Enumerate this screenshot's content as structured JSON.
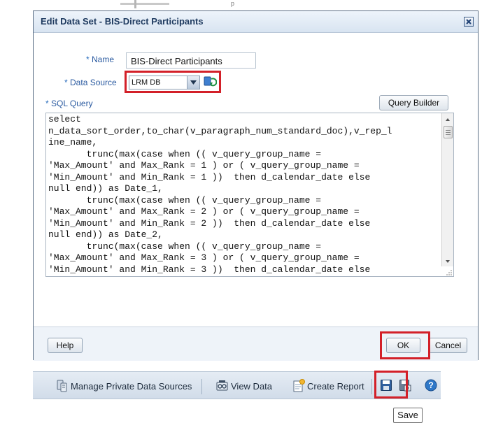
{
  "dialog": {
    "title": "Edit Data Set - BIS-Direct Participants",
    "close_icon": "close-icon",
    "name": {
      "required_mark": "*",
      "label": "Name",
      "value": "BIS-Direct Participants"
    },
    "data_source": {
      "required_mark": "*",
      "label": "Data Source",
      "value": "LRM DB",
      "refresh_icon": "refresh-datasource-icon"
    },
    "sql_query": {
      "required_mark": "*",
      "label": "SQL Query",
      "query_builder_label": "Query Builder",
      "text": "select\nn_data_sort_order,to_char(v_paragraph_num_standard_doc),v_rep_l\nine_name,\n       trunc(max(case when (( v_query_group_name =\n'Max_Amount' and Max_Rank = 1 ) or ( v_query_group_name =\n'Min_Amount' and Min_Rank = 1 ))  then d_calendar_date else\nnull end)) as Date_1,\n       trunc(max(case when (( v_query_group_name =\n'Max_Amount' and Max_Rank = 2 ) or ( v_query_group_name =\n'Min_Amount' and Min_Rank = 2 ))  then d_calendar_date else\nnull end)) as Date_2,\n       trunc(max(case when (( v_query_group_name =\n'Max_Amount' and Max_Rank = 3 ) or ( v_query_group_name =\n'Min_Amount' and Min_Rank = 3 ))  then d_calendar_date else"
    },
    "buttons": {
      "help": "Help",
      "ok": "OK",
      "cancel": "Cancel"
    }
  },
  "toolbar": {
    "items": [
      {
        "label": "Manage Private Data Sources",
        "icon": "manage-datasources-icon"
      },
      {
        "label": "View Data",
        "icon": "view-data-icon"
      },
      {
        "label": "Create Report",
        "icon": "create-report-icon"
      }
    ],
    "icon_buttons": [
      "save-icon",
      "save-as-icon",
      "help-icon"
    ]
  },
  "tooltip": {
    "text": "Save"
  },
  "colors": {
    "highlight": "#d32029",
    "label_blue": "#2a5aa0",
    "title_blue": "#1e3a5f"
  }
}
